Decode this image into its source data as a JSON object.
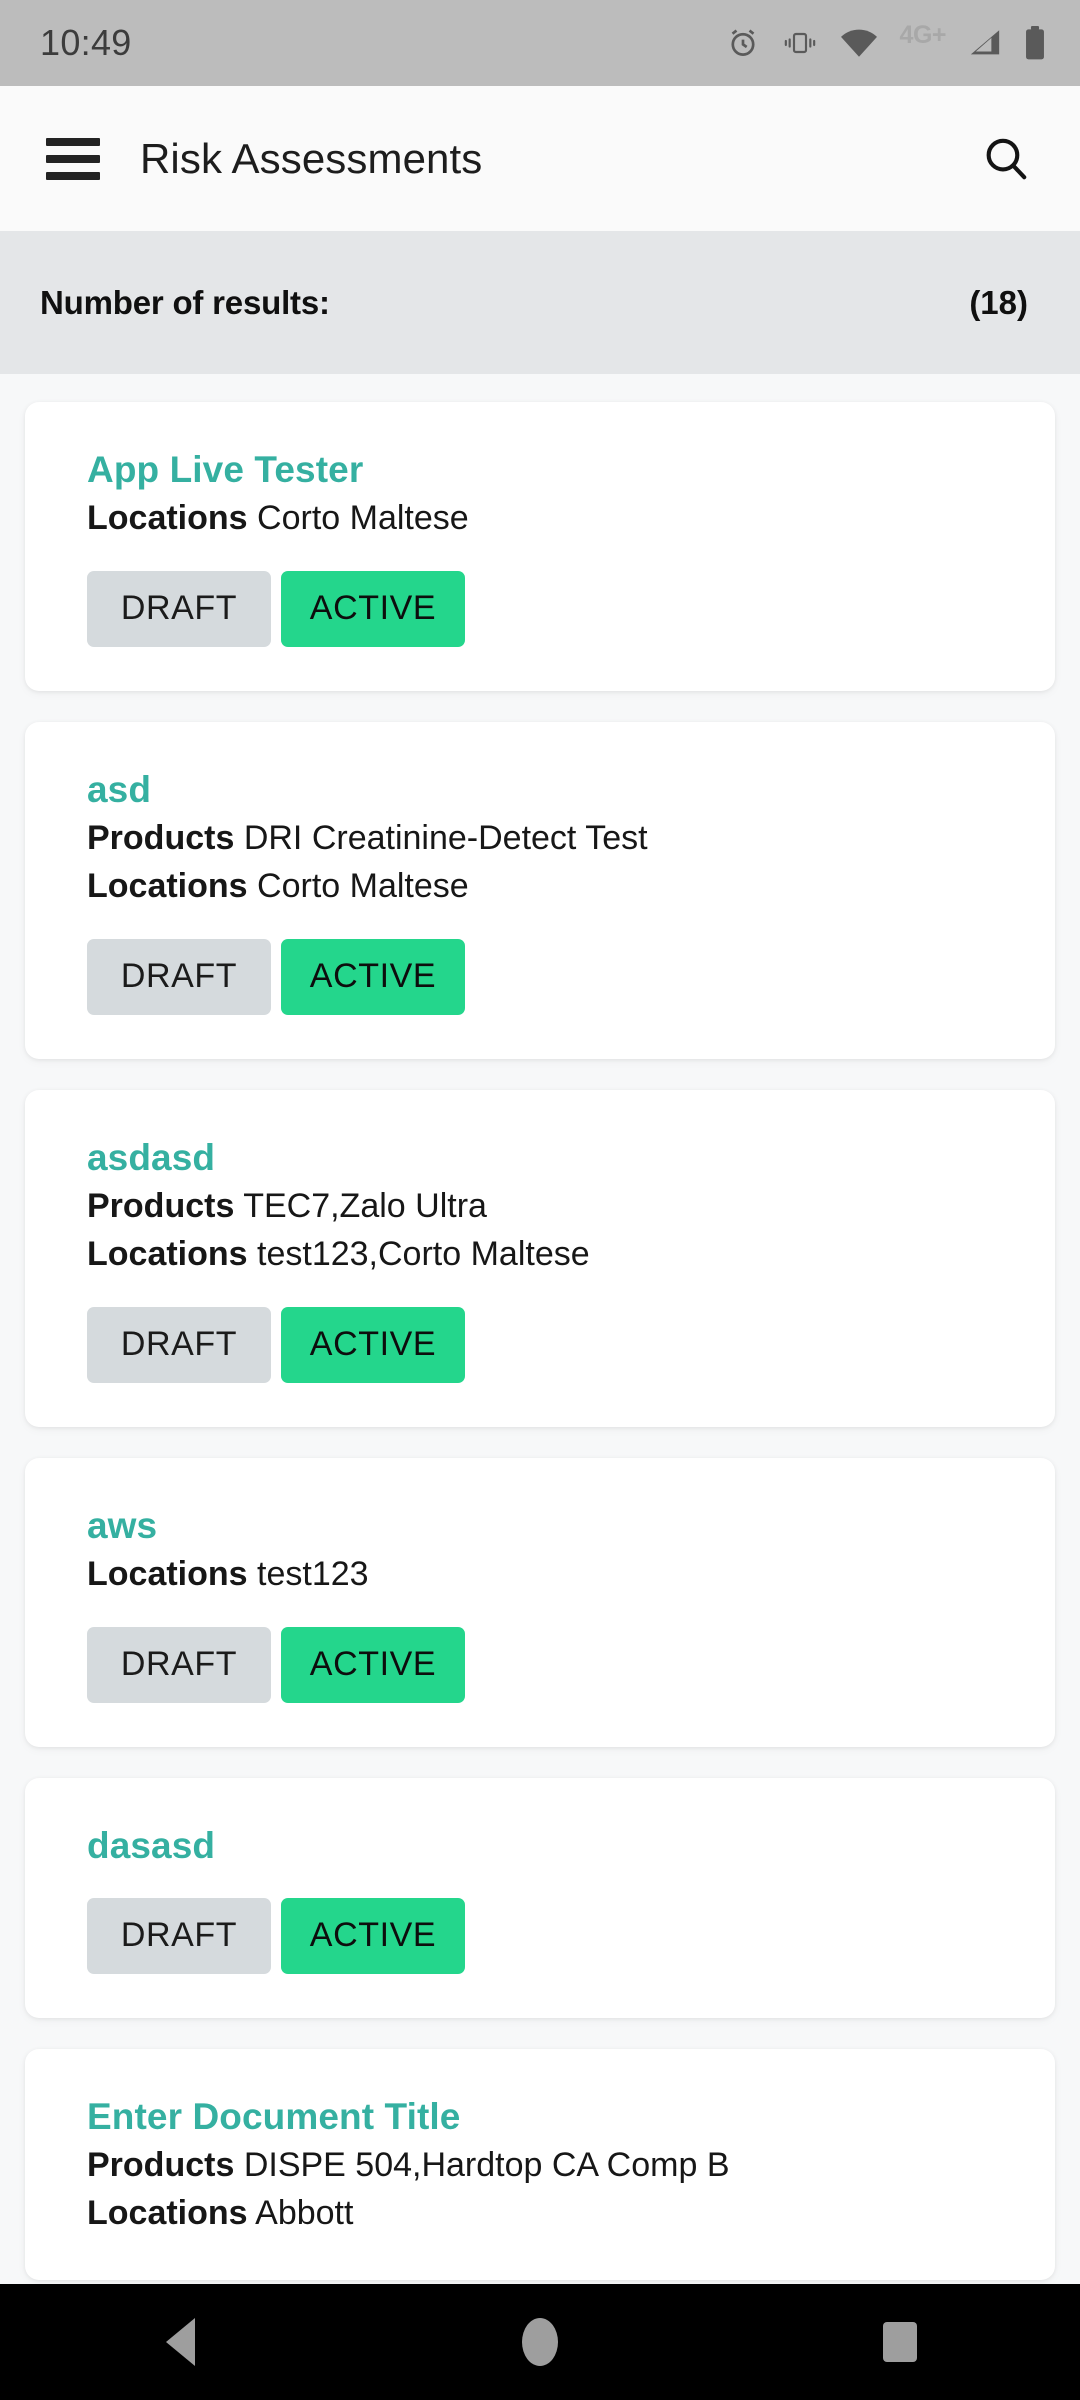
{
  "status_bar": {
    "time": "10:49",
    "network_label": "4G+",
    "icons": [
      "alarm-icon",
      "vibrate-icon",
      "wifi-icon",
      "signal-icon",
      "battery-icon"
    ]
  },
  "app_bar": {
    "menu_icon": "hamburger-menu-icon",
    "title": "Risk Assessments",
    "search_icon": "search-icon"
  },
  "results_bar": {
    "label": "Number of results:",
    "count": "(18)"
  },
  "colors": {
    "title_teal": "#35b0a1",
    "chip_active_green": "#24d68c",
    "chip_draft_gray": "#d5dadd",
    "page_background": "#f7f8f9",
    "results_bar_background": "#e4e6e8",
    "status_bar_background": "#bcbcbc"
  },
  "chip_labels": {
    "draft": "DRAFT",
    "active": "ACTIVE"
  },
  "meta_keys": {
    "products": "Products",
    "locations": "Locations"
  },
  "cards": [
    {
      "title": "App Live Tester",
      "products": null,
      "locations": "Corto Maltese",
      "draft": "DRAFT",
      "active": "ACTIVE"
    },
    {
      "title": "asd",
      "products": "DRI Creatinine-Detect Test",
      "locations": "Corto Maltese",
      "draft": "DRAFT",
      "active": "ACTIVE"
    },
    {
      "title": "asdasd",
      "products": "TEC7,Zalo Ultra",
      "locations": "test123,Corto Maltese",
      "draft": "DRAFT",
      "active": "ACTIVE"
    },
    {
      "title": "aws",
      "products": null,
      "locations": "test123",
      "draft": "DRAFT",
      "active": "ACTIVE"
    },
    {
      "title": "dasasd",
      "products": null,
      "locations": null,
      "draft": "DRAFT",
      "active": "ACTIVE"
    },
    {
      "title": "Enter Document Title",
      "products": "DISPE 504,Hardtop CA Comp B",
      "locations": "Abbott",
      "draft": null,
      "active": null
    }
  ],
  "nav_bar": {
    "back": "back-nav-button",
    "home": "home-nav-button",
    "recents": "recents-nav-button"
  }
}
